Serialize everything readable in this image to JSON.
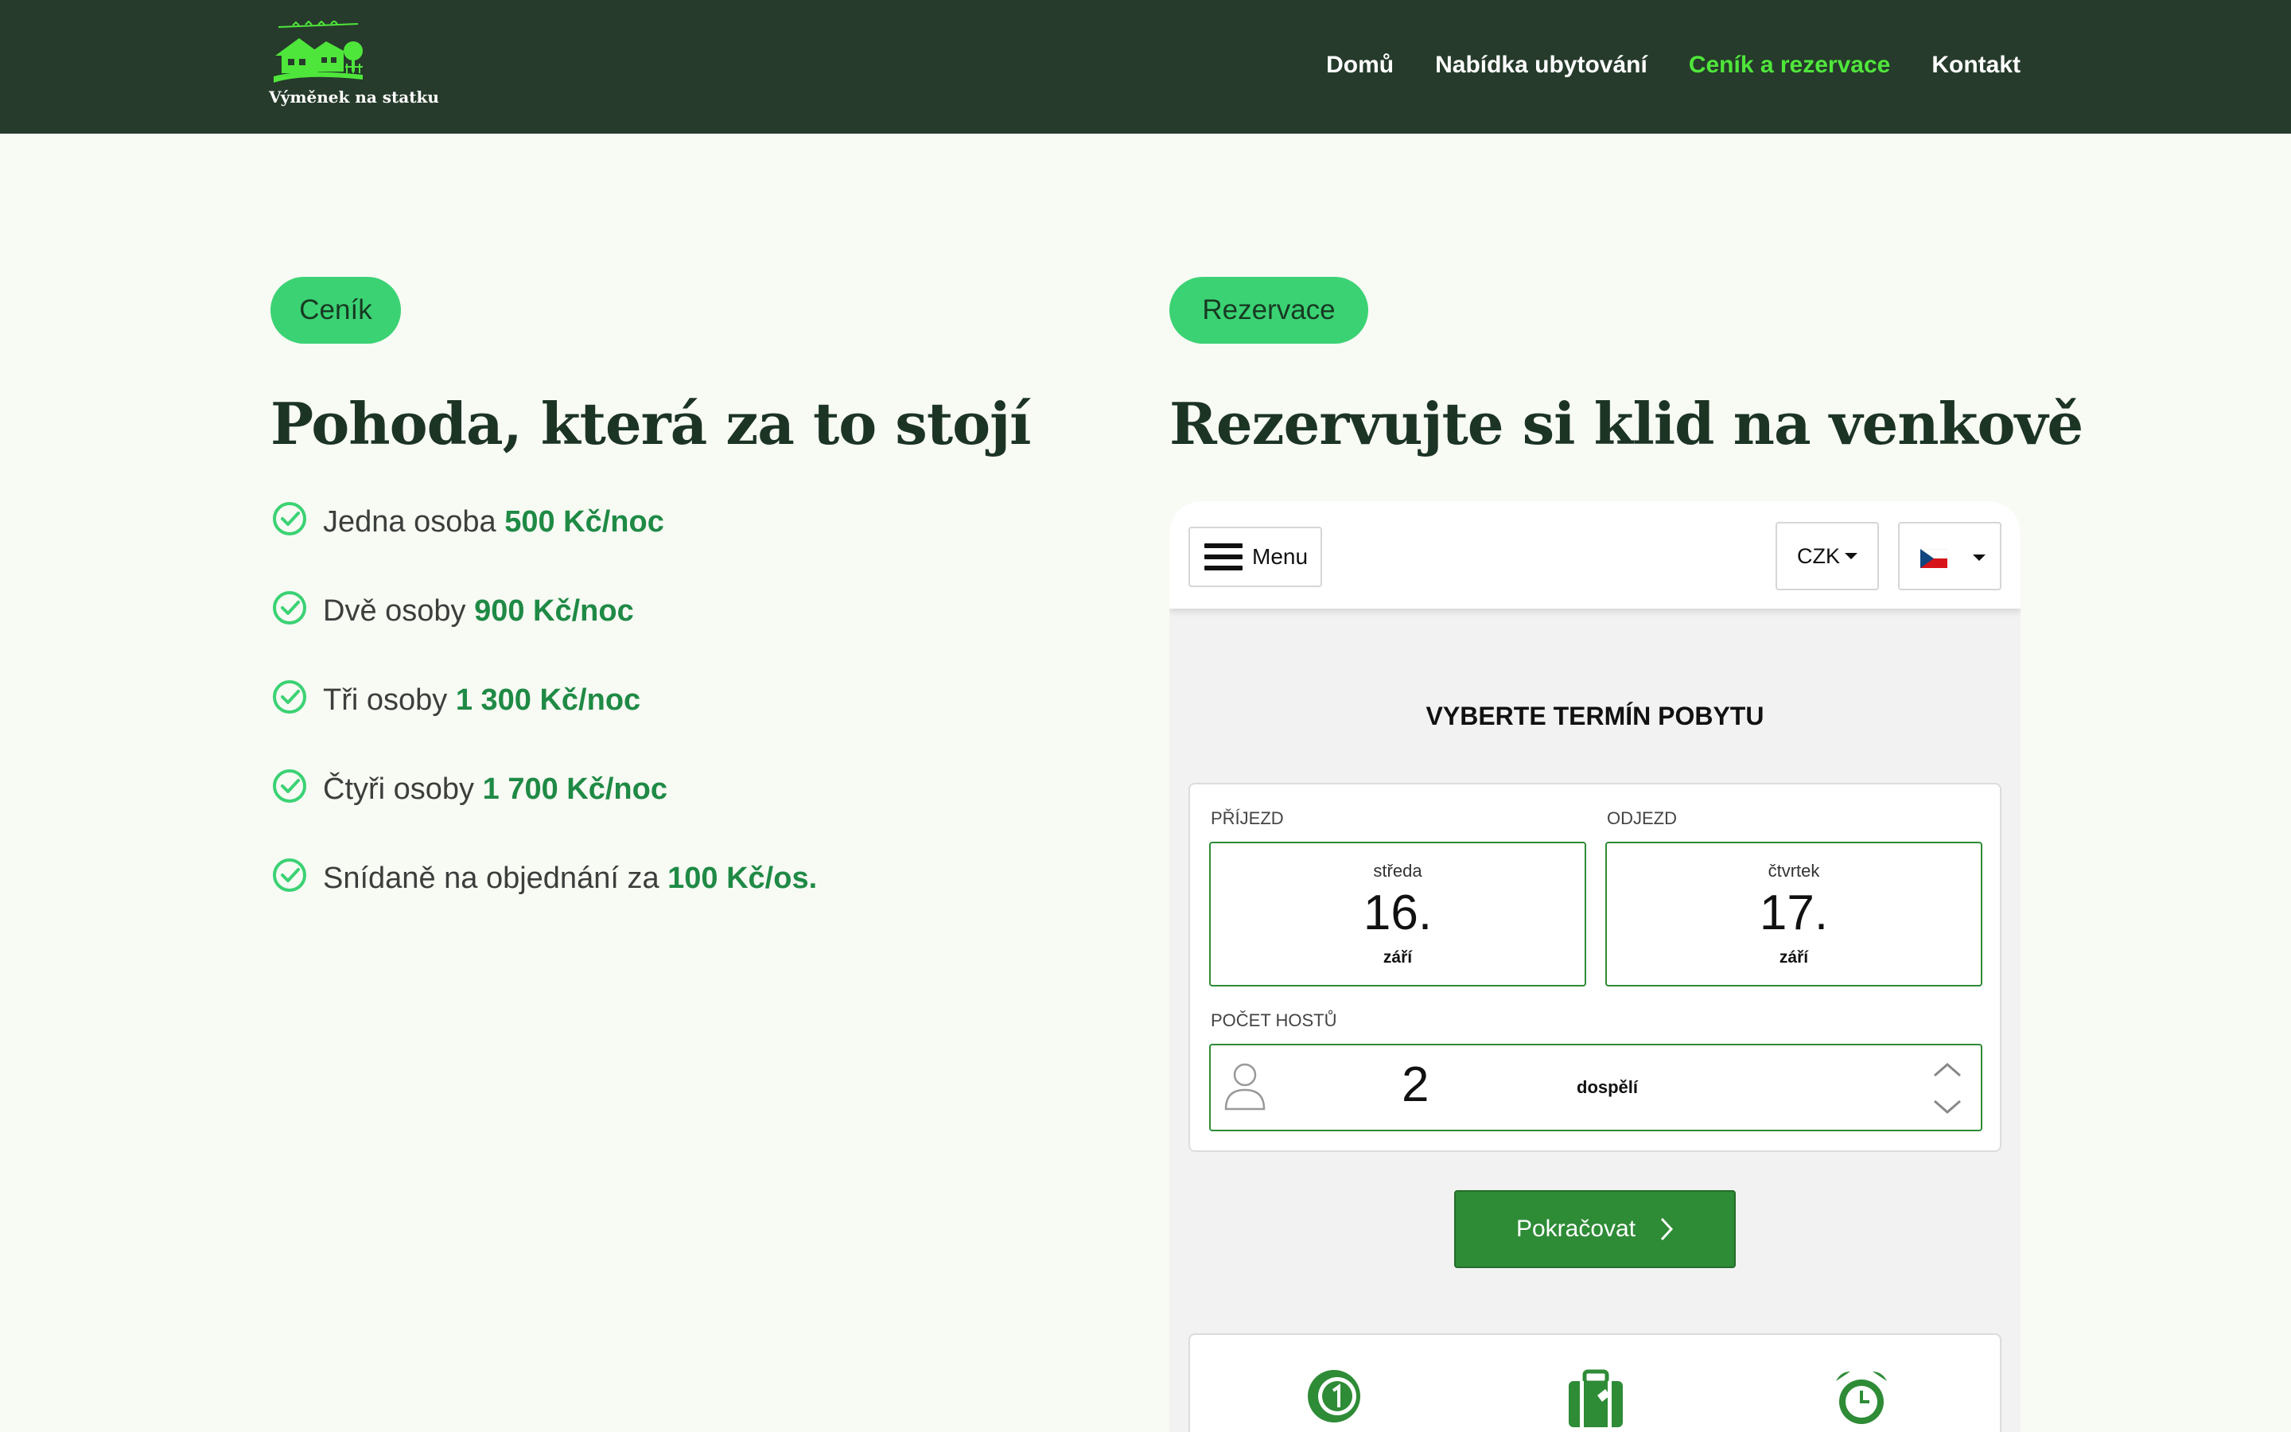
{
  "header": {
    "logo_text": "Výměnek na statku",
    "nav": [
      {
        "label": "Domů",
        "active": false
      },
      {
        "label": "Nabídka ubytování",
        "active": false
      },
      {
        "label": "Ceník a rezervace",
        "active": true
      },
      {
        "label": "Kontakt",
        "active": false
      }
    ]
  },
  "pricing": {
    "badge": "Ceník",
    "heading": "Pohoda, která za to stojí",
    "items": [
      {
        "text": "Jedna osoba ",
        "price": "500 Kč/noc"
      },
      {
        "text": "Dvě osoby ",
        "price": "900 Kč/noc"
      },
      {
        "text": "Tři osoby ",
        "price": "1 300 Kč/noc"
      },
      {
        "text": "Čtyři osoby ",
        "price": "1 700 Kč/noc"
      },
      {
        "text": "Snídaně na objednání za ",
        "price": "100 Kč/os."
      }
    ]
  },
  "reservation": {
    "badge": "Rezervace",
    "heading": "Rezervujte si klid na venkově",
    "widget": {
      "menu_label": "Menu",
      "currency": "CZK",
      "language_icon": "czech-flag-icon",
      "title": "VYBERTE TERMÍN POBYTU",
      "arrival_label": "PŘÍJEZD",
      "departure_label": "ODJEZD",
      "arrival": {
        "weekday": "středa",
        "day": "16.",
        "month": "září"
      },
      "departure": {
        "weekday": "čtvrtek",
        "day": "17.",
        "month": "září"
      },
      "guests_label": "POČET HOSTŮ",
      "guests_count": "2",
      "guests_unit": "dospělí",
      "continue_label": "Pokračovat",
      "feature_icons": [
        "coin-one-icon",
        "luggage-icon",
        "alarm-clock-icon"
      ]
    }
  },
  "colors": {
    "header_bg": "#263b2b",
    "nav_active": "#4fe63b",
    "badge_bg": "#3bd274",
    "price_green": "#1f8a45",
    "button_green": "#2e8b36",
    "page_bg": "#f8faf4"
  }
}
